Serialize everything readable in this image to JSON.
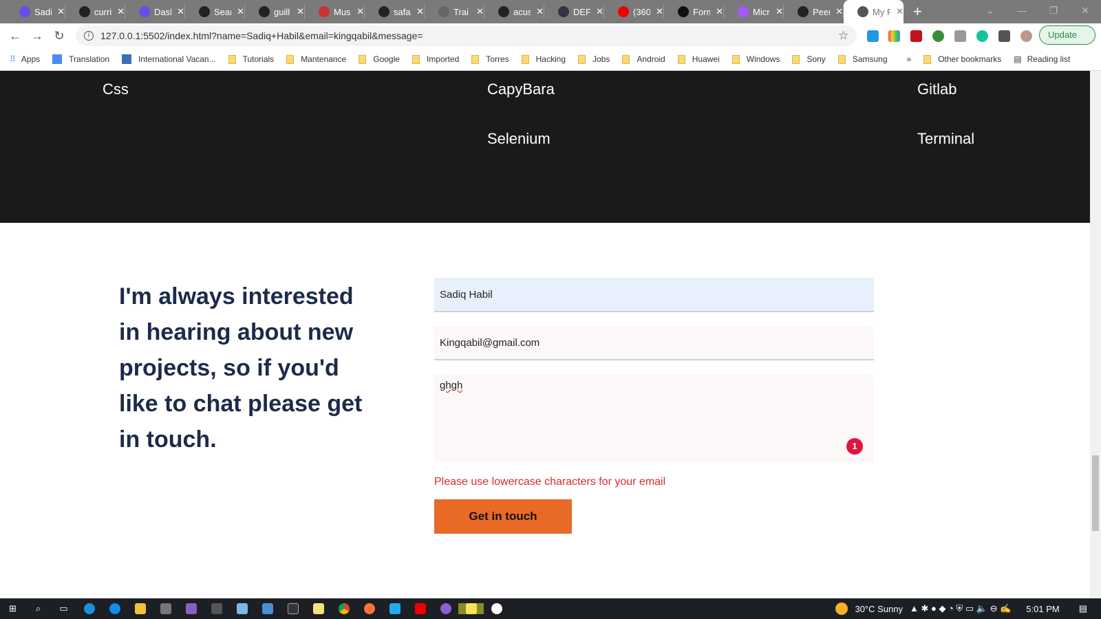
{
  "browser": {
    "tabs": [
      {
        "label": "Sadiq",
        "color": "#6b4ce6"
      },
      {
        "label": "curri",
        "color": "#222"
      },
      {
        "label": "Dash",
        "color": "#6b4ce6"
      },
      {
        "label": "Sear",
        "color": "#222"
      },
      {
        "label": "guill",
        "color": "#222"
      },
      {
        "label": "Mus",
        "color": "#c33"
      },
      {
        "label": "safa",
        "color": "#222"
      },
      {
        "label": "Trai",
        "color": "#666"
      },
      {
        "label": "acus",
        "color": "#222"
      },
      {
        "label": "DEF",
        "color": "#334"
      },
      {
        "label": "(360",
        "color": "#e00"
      },
      {
        "label": "Form",
        "color": "#111"
      },
      {
        "label": "Micr",
        "color": "#a259ff"
      },
      {
        "label": "Peer",
        "color": "#222"
      },
      {
        "label": "My P",
        "color": "#555"
      }
    ],
    "close_glyph": "✕",
    "new_tab": "+",
    "url": "127.0.0.1:5502/index.html?name=Sadiq+Habil&email=kingqabil&message=",
    "update_label": "Update",
    "bookmarks": [
      "Apps",
      "Translation",
      "International Vacan...",
      "Tutorials",
      "Mantenance",
      "Google",
      "Imported",
      "Torres",
      "Hacking",
      "Jobs",
      "Android",
      "Huawei",
      "Windows",
      "Sony",
      "Samsung"
    ],
    "more": "»",
    "other_bookmarks": "Other bookmarks",
    "reading_list": "Reading list"
  },
  "page": {
    "skills": [
      "Css",
      "CapyBara",
      "Gitlab",
      "Selenium",
      "Terminal"
    ],
    "heading": "I'm always interested in hearing about new projects, so if you'd like to chat please get in touch.",
    "form": {
      "name_value": "Sadiq Habil",
      "email_value": "Kingqabil@gmail.com",
      "message_value": "ghgh",
      "badge": "1",
      "error": "Please use lowercase characters for your email",
      "submit": "Get in touch"
    },
    "accent": "#e96a26"
  },
  "taskbar": {
    "weather": "30°C  Sunny",
    "time": "5:01 PM"
  }
}
